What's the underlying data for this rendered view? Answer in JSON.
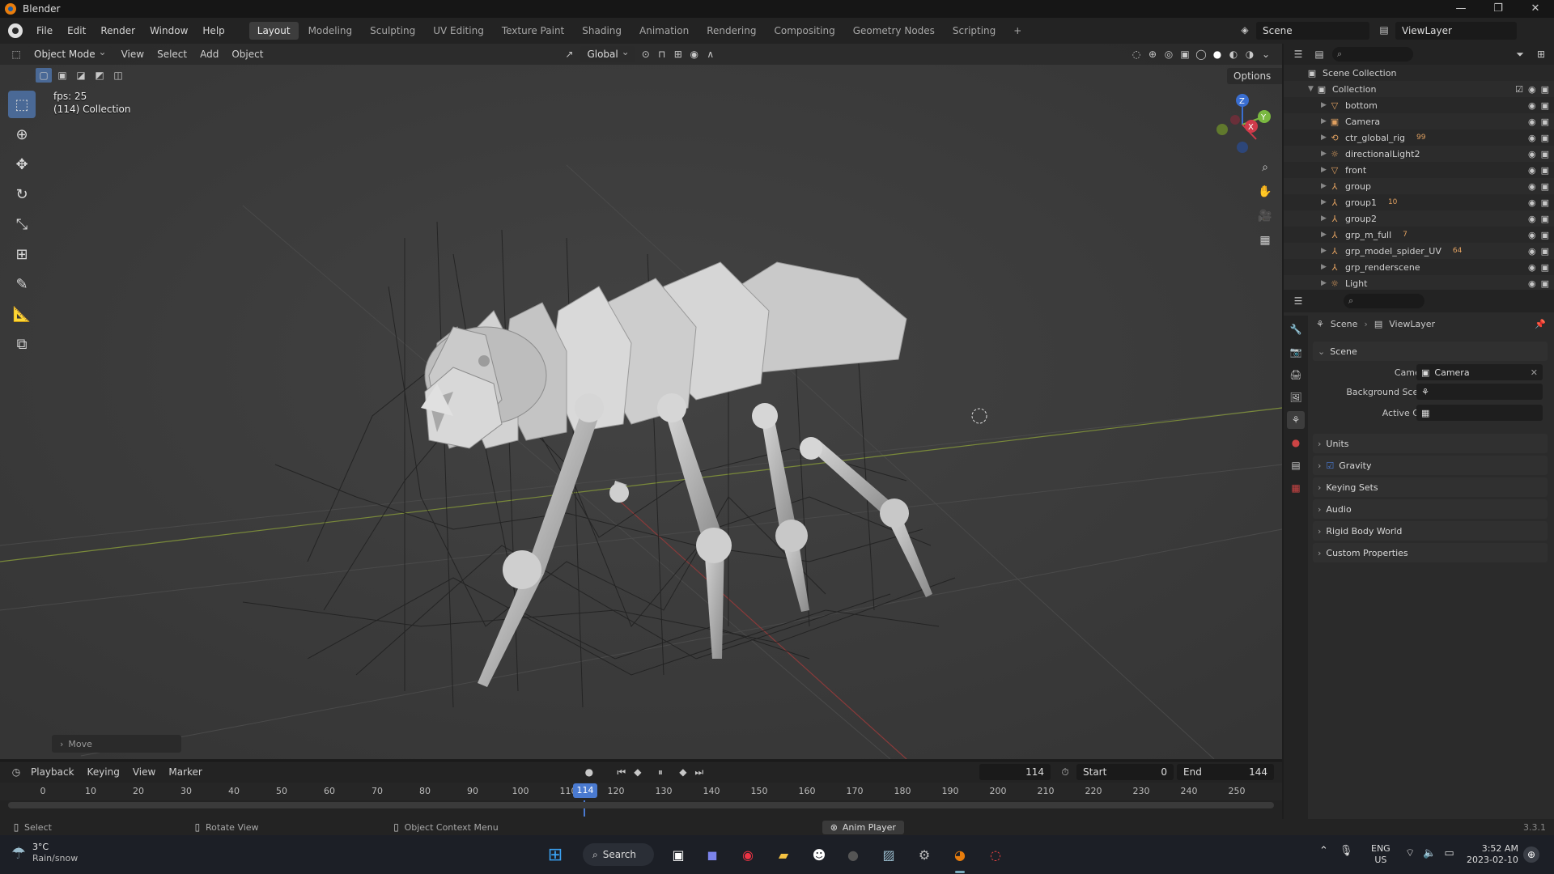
{
  "titlebar": {
    "title": "Blender",
    "min": "—",
    "max": "❐",
    "close": "✕"
  },
  "menu": [
    "File",
    "Edit",
    "Render",
    "Window",
    "Help"
  ],
  "workspaces": [
    "Layout",
    "Modeling",
    "Sculpting",
    "UV Editing",
    "Texture Paint",
    "Shading",
    "Animation",
    "Rendering",
    "Compositing",
    "Geometry Nodes",
    "Scripting",
    "+"
  ],
  "scene_name": "Scene",
  "view_layer": "ViewLayer",
  "viewport": {
    "mode": "Object Mode",
    "menus": [
      "View",
      "Select",
      "Add",
      "Object"
    ],
    "orientation": "Global",
    "options": "Options",
    "fps": "fps: 25",
    "collection_info": "(114) Collection",
    "last_op": "Move",
    "gizmo": {
      "x": "X",
      "y": "Y",
      "z": "Z"
    }
  },
  "timeline": {
    "menus": [
      "Playback",
      "Keying",
      "View",
      "Marker"
    ],
    "current_frame": "114",
    "start_label": "Start",
    "start": "0",
    "end_label": "End",
    "end": "144",
    "ticks": [
      "0",
      "10",
      "20",
      "30",
      "40",
      "50",
      "60",
      "70",
      "80",
      "90",
      "100",
      "110",
      "120",
      "130",
      "140",
      "150",
      "160",
      "170",
      "180",
      "190",
      "200",
      "210",
      "220",
      "230",
      "240",
      "250"
    ],
    "playhead": "114"
  },
  "statusbar": {
    "select": "Select",
    "rotate": "Rotate View",
    "context": "Object Context Menu",
    "anim_player": "Anim Player",
    "version": "3.3.1"
  },
  "outliner": {
    "root": "Scene Collection",
    "collection": "Collection",
    "items": [
      {
        "name": "bottom",
        "extra": ""
      },
      {
        "name": "Camera",
        "extra": ""
      },
      {
        "name": "ctr_global_rig",
        "extra": "99"
      },
      {
        "name": "directionalLight2",
        "extra": ""
      },
      {
        "name": "front",
        "extra": ""
      },
      {
        "name": "group",
        "extra": ""
      },
      {
        "name": "group1",
        "extra": "10"
      },
      {
        "name": "group2",
        "extra": ""
      },
      {
        "name": "grp_m_full",
        "extra": "7"
      },
      {
        "name": "grp_model_spider_UV",
        "extra": "64"
      },
      {
        "name": "grp_renderscene",
        "extra": ""
      },
      {
        "name": "Light",
        "extra": ""
      }
    ]
  },
  "properties": {
    "breadcrumb_scene": "Scene",
    "breadcrumb_layer": "ViewLayer",
    "section": "Scene",
    "camera_label": "Camera",
    "camera_value": "Camera",
    "bg_scene_label": "Background Scene",
    "active_clip_label": "Active Clip",
    "panels": [
      "Units",
      "Gravity",
      "Keying Sets",
      "Audio",
      "Rigid Body World",
      "Custom Properties"
    ]
  },
  "taskbar": {
    "weather_temp": "3°C",
    "weather_desc": "Rain/snow",
    "search": "Search",
    "lang": "ENG",
    "region": "US",
    "time": "3:52 AM",
    "date": "2023-02-10"
  }
}
